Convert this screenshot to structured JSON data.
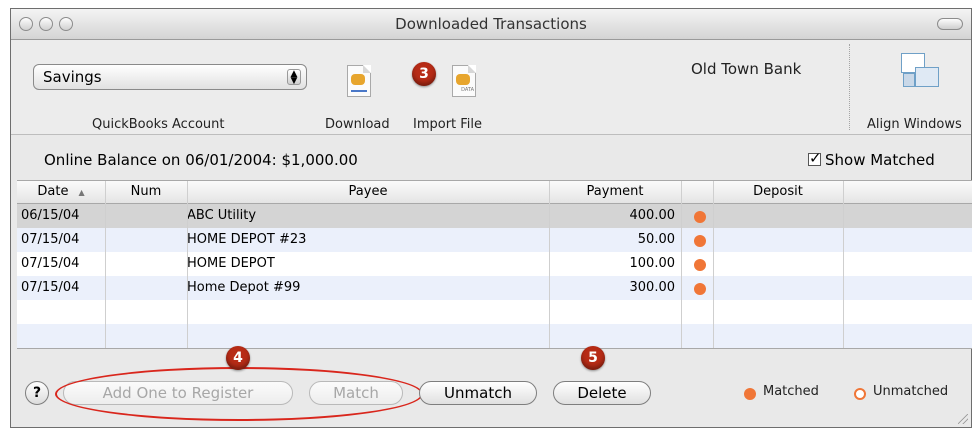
{
  "window": {
    "title": "Downloaded Transactions"
  },
  "toolbar": {
    "account_select": "Savings",
    "account_label": "QuickBooks Account",
    "download_label": "Download",
    "import_label": "Import File",
    "import_icon_text": "DATA",
    "bank_name": "Old Town Bank",
    "align_label": "Align Windows"
  },
  "balance": {
    "text": "Online Balance on 06/01/2004: $1,000.00"
  },
  "show_matched": {
    "label": "Show Matched",
    "checked": true
  },
  "table": {
    "columns": [
      "Date",
      "Num",
      "Payee",
      "Payment",
      "",
      "Deposit"
    ],
    "rows": [
      {
        "date": "06/15/04",
        "num": "",
        "payee": "ABC Utility",
        "payment": "400.00",
        "status": "matched",
        "deposit": ""
      },
      {
        "date": "07/15/04",
        "num": "",
        "payee": "HOME DEPOT #23",
        "payment": "50.00",
        "status": "matched",
        "deposit": ""
      },
      {
        "date": "07/15/04",
        "num": "",
        "payee": "HOME DEPOT",
        "payment": "100.00",
        "status": "matched",
        "deposit": ""
      },
      {
        "date": "07/15/04",
        "num": "",
        "payee": "Home Depot #99",
        "payment": "300.00",
        "status": "matched",
        "deposit": ""
      }
    ]
  },
  "buttons": {
    "help": "?",
    "add": "Add One to Register",
    "match": "Match",
    "unmatch": "Unmatch",
    "delete": "Delete"
  },
  "legend": {
    "matched": "Matched",
    "unmatched": "Unmatched"
  },
  "markers": {
    "m3": "3",
    "m4": "4",
    "m5": "5"
  },
  "colors": {
    "matched_dot": "#f07637",
    "marker": "#b72b16",
    "highlight_oval": "#d9261c",
    "selected_row": "#d4d4d4",
    "alt_row": "#ebf0fb"
  }
}
